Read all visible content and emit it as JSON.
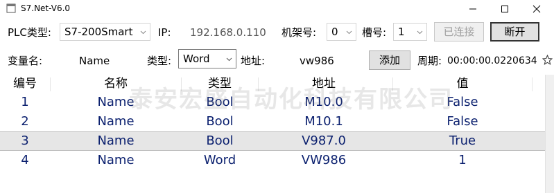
{
  "window": {
    "title": "S7.Net-V6.0",
    "controls": {
      "minimize": "–",
      "maximize": "☐",
      "close": "✕"
    }
  },
  "connection": {
    "plc_type_label": "PLC类型:",
    "plc_type_value": "S7-200Smart",
    "ip_label": "IP:",
    "ip_value": "192.168.0.110",
    "rack_label": "机架号:",
    "rack_value": "0",
    "slot_label": "槽号:",
    "slot_value": "1",
    "connected_button": "已连接",
    "disconnect_button": "断开"
  },
  "variable": {
    "name_label": "变量名:",
    "name_value": "Name",
    "type_label": "类型:",
    "type_value": "Word",
    "address_label": "地址:",
    "address_value": "vw986",
    "add_button": "添加",
    "period_label": "周期:",
    "period_value": "00:00:00.0220634"
  },
  "table": {
    "columns": [
      "编号",
      "名称",
      "类型",
      "地址",
      "值"
    ],
    "rows": [
      {
        "id": "1",
        "name": "Name",
        "type": "Bool",
        "address": "M10.0",
        "value": "False"
      },
      {
        "id": "2",
        "name": "Name",
        "type": "Bool",
        "address": "M10.1",
        "value": "False"
      },
      {
        "id": "3",
        "name": "Name",
        "type": "Bool",
        "address": "V987.0",
        "value": "True"
      },
      {
        "id": "4",
        "name": "Name",
        "type": "Word",
        "address": "VW986",
        "value": "1"
      }
    ],
    "selected_row": 3
  },
  "watermark": "泰安宏盛自动化科技有限公司",
  "colors": {
    "cell_text": "#0a1f6e",
    "selected_row": "#e6e6e6"
  }
}
